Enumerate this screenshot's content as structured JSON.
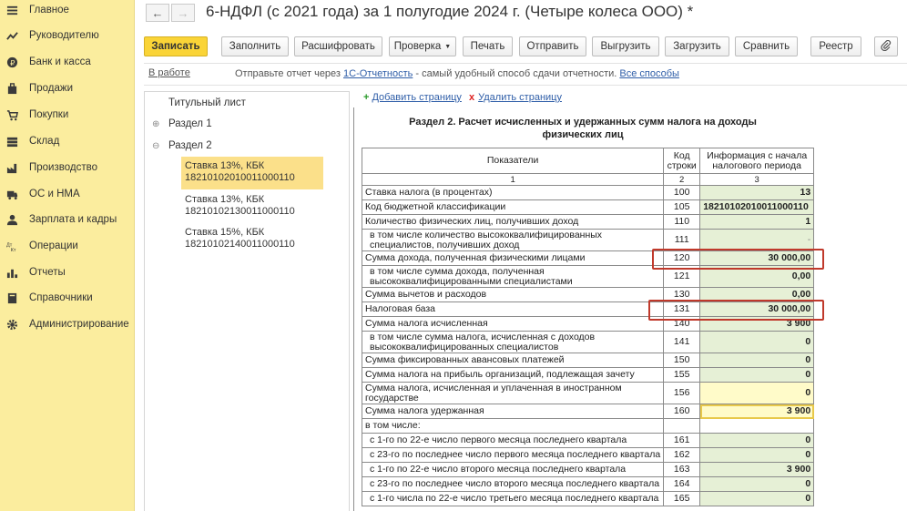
{
  "sidebar": {
    "items": [
      {
        "label": "Главное",
        "icon": "menu-icon"
      },
      {
        "label": "Руководителю",
        "icon": "trend-icon"
      },
      {
        "label": "Банк и касса",
        "icon": "coin-icon"
      },
      {
        "label": "Продажи",
        "icon": "bag-icon"
      },
      {
        "label": "Покупки",
        "icon": "cart-icon"
      },
      {
        "label": "Склад",
        "icon": "warehouse-icon"
      },
      {
        "label": "Производство",
        "icon": "factory-icon"
      },
      {
        "label": "ОС и НМА",
        "icon": "truck-icon"
      },
      {
        "label": "Зарплата и кадры",
        "icon": "person-icon"
      },
      {
        "label": "Операции",
        "icon": "operations-icon"
      },
      {
        "label": "Отчеты",
        "icon": "bar-chart-icon"
      },
      {
        "label": "Справочники",
        "icon": "book-icon"
      },
      {
        "label": "Администрирование",
        "icon": "gear-icon"
      }
    ]
  },
  "window": {
    "title": "6-НДФЛ (с 2021 года) за 1 полугодие 2024 г. (Четыре колеса ООО) *",
    "back_icon": "←",
    "forward_icon": "→"
  },
  "toolbar": {
    "save": "Записать",
    "fill": "Заполнить",
    "decode": "Расшифровать",
    "check": "Проверка",
    "print": "Печать",
    "send": "Отправить",
    "export": "Выгрузить",
    "import": "Загрузить",
    "compare": "Сравнить",
    "registry": "Реестр",
    "attach_icon": "paperclip-icon"
  },
  "status": {
    "state": "В работе",
    "message_prefix": "Отправьте отчет через ",
    "service_link": "1С-Отчетность",
    "message_middle": " - самый удобный способ сдачи отчетности. ",
    "all_methods_link": "Все способы"
  },
  "tree": {
    "title_page": "Титульный лист",
    "section1": "Раздел 1",
    "section2": "Раздел 2",
    "sub": [
      {
        "line1": "Ставка 13%, КБК",
        "line2": "18210102010011000110",
        "selected": true
      },
      {
        "line1": "Ставка 13%, КБК",
        "line2": "18210102130011000110",
        "selected": false
      },
      {
        "line1": "Ставка 15%, КБК",
        "line2": "18210102140011000110",
        "selected": false
      }
    ]
  },
  "actions": {
    "add_page": "Добавить страницу",
    "delete_page": "Удалить страницу"
  },
  "form": {
    "heading_line1": "Раздел 2. Расчет исчисленных и удержанных сумм налога на доходы",
    "heading_line2": "физических лиц",
    "columns": [
      "Показатели",
      "Код строки",
      "Информация с начала налогового периода"
    ],
    "column_numbers": [
      "1",
      "2",
      "3"
    ],
    "rows": [
      {
        "label": "Ставка налога (в процентах)",
        "code": "100",
        "value": "13"
      },
      {
        "label": "Код бюджетной классификации",
        "code": "105",
        "value": "18210102010011000110"
      },
      {
        "label": "Количество физических лиц, получивших доход",
        "code": "110",
        "value": "1"
      },
      {
        "label": "в том числе количество высококвалифицированных специалистов, получивших доход",
        "code": "111",
        "value": "-"
      },
      {
        "label": "Сумма дохода, полученная физическими лицами",
        "code": "120",
        "value": "30 000,00"
      },
      {
        "label": "в том числе сумма дохода, полученная высококвалифицированными специалистами",
        "code": "121",
        "value": "0,00"
      },
      {
        "label": "Сумма вычетов и расходов",
        "code": "130",
        "value": "0,00"
      },
      {
        "label": "Налоговая база",
        "code": "131",
        "value": "30 000,00"
      },
      {
        "label": "Сумма налога исчисленная",
        "code": "140",
        "value": "3 900"
      },
      {
        "label": "в том числе сумма налога, исчисленная с доходов высококвалифицированных специалистов",
        "code": "141",
        "value": "0"
      },
      {
        "label": "Сумма фиксированных авансовых платежей",
        "code": "150",
        "value": "0"
      },
      {
        "label": "Сумма налога на прибыль организаций, подлежащая зачету",
        "code": "155",
        "value": "0"
      },
      {
        "label": "Сумма налога, исчисленная и уплаченная в иностранном государстве",
        "code": "156",
        "value": "0"
      },
      {
        "label": "Сумма налога удержанная",
        "code": "160",
        "value": "3 900"
      },
      {
        "label": "в том числе:",
        "code": "",
        "value": ""
      },
      {
        "label": "с 1-го по 22-е число первого месяца последнего квартала",
        "code": "161",
        "value": "0"
      },
      {
        "label": "с 23-го по последнее число первого месяца последнего квартала",
        "code": "162",
        "value": "0"
      },
      {
        "label": "с 1-го по 22-е число второго месяца последнего квартала",
        "code": "163",
        "value": "3 900"
      },
      {
        "label": "с 23-го по последнее число второго месяца последнего квартала",
        "code": "164",
        "value": "0"
      },
      {
        "label": "с 1-го числа по 22-е число третьего месяца последнего квартала",
        "code": "165",
        "value": "0"
      }
    ]
  }
}
